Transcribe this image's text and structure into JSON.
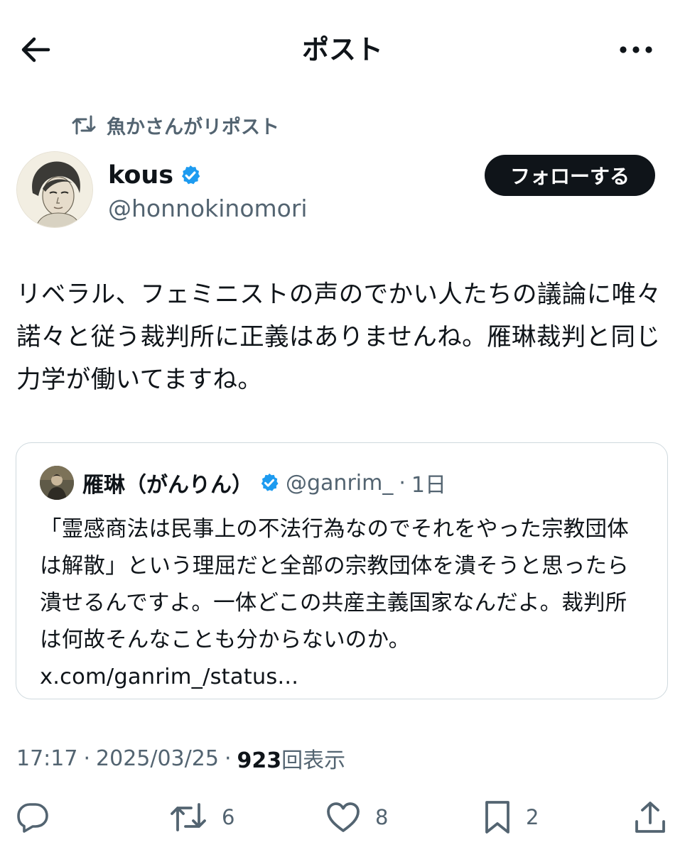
{
  "header": {
    "title": "ポスト"
  },
  "repost_context": {
    "text": "魚かさんがリポスト"
  },
  "author": {
    "name": "kous",
    "handle": "@honnokinomori",
    "follow_label": "フォローする"
  },
  "post": {
    "text": "リベラル、フェミニストの声のでかい人たちの議論に唯々諾々と従う裁判所に正義はありませんね。雁琳裁判と同じ力学が働いてますね。"
  },
  "quote": {
    "author_name": "雁琳（がんりん）",
    "handle": "@ganrim_",
    "separator": "·",
    "time": "1日",
    "text": "「霊感商法は民事上の不法行為なのでそれをやった宗教団体は解散」という理屈だと全部の宗教団体を潰そうと思ったら潰せるんですよ。一体どこの共産主義国家なんだよ。裁判所は何故そんなことも分からないのか。",
    "link": "x.com/ganrim_/status..."
  },
  "meta": {
    "time": "17:17",
    "separator": "·",
    "date": "2025/03/25",
    "views_count": "923",
    "views_label": "回表示"
  },
  "actions": {
    "reply_count": "",
    "repost_count": "6",
    "like_count": "8",
    "bookmark_count": "2"
  },
  "colors": {
    "text": "#0f1419",
    "muted": "#536471",
    "verified": "#1d9bf0",
    "border": "#cfd9de",
    "follow_bg": "#0f1419"
  },
  "icons": {
    "back": "arrow-left-icon",
    "more": "more-horizontal-icon",
    "repost": "repost-icon",
    "verified": "verified-badge-icon",
    "reply": "reply-icon",
    "like": "heart-icon",
    "bookmark": "bookmark-icon",
    "share": "share-icon"
  }
}
